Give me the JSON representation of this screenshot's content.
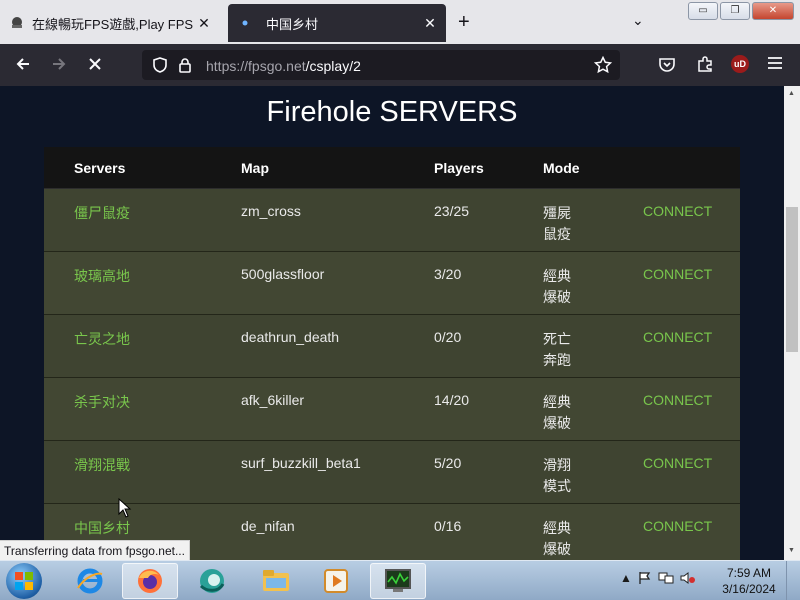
{
  "browser": {
    "tabs": [
      {
        "label": "在線暢玩FPS遊戲,Play FPS Gam",
        "close": "✕"
      },
      {
        "label": "中国乡村",
        "close": "✕"
      }
    ],
    "new_tab": "+",
    "list_tabs": "⌄",
    "window_buttons": [
      "▭",
      "❐",
      "✕"
    ],
    "url_host": "https://fpsgo.net",
    "url_path": "/csplay/2",
    "ublock_label": "uD"
  },
  "page": {
    "title": "Firehole SERVERS",
    "headers": {
      "servers": "Servers",
      "map": "Map",
      "players": "Players",
      "mode": "Mode"
    },
    "rows": [
      {
        "name": "僵尸鼠疫",
        "map": "zm_cross",
        "players": "23/25",
        "mode": "殭屍鼠疫",
        "action": "CONNECT"
      },
      {
        "name": "玻璃高地",
        "map": "500glassfloor",
        "players": "3/20",
        "mode": "經典爆破",
        "action": "CONNECT"
      },
      {
        "name": "亡灵之地",
        "map": "deathrun_death",
        "players": "0/20",
        "mode": "死亡奔跑",
        "action": "CONNECT"
      },
      {
        "name": "杀手对决",
        "map": "afk_6killer",
        "players": "14/20",
        "mode": "經典爆破",
        "action": "CONNECT"
      },
      {
        "name": "滑翔混戰",
        "map": "surf_buzzkill_beta1",
        "players": "5/20",
        "mode": "滑翔模式",
        "action": "CONNECT"
      },
      {
        "name": "中国乡村",
        "map": "de_nifan",
        "players": "0/16",
        "mode": "經典爆破",
        "action": "CONNECT"
      }
    ]
  },
  "status_bar": "Transferring data from fpsgo.net...",
  "taskbar": {
    "time": "7:59 AM",
    "date": "3/16/2024"
  }
}
